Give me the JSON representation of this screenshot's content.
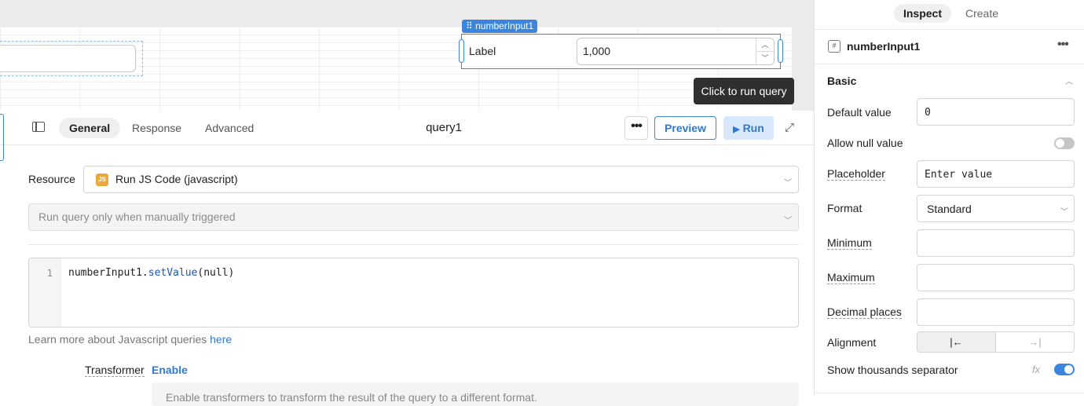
{
  "canvas": {
    "component_tag": "numberInput1",
    "number_input": {
      "label": "Label",
      "value": "1,000"
    },
    "tooltip": "Click to run query"
  },
  "query_editor": {
    "tabs": [
      {
        "label": "General",
        "active": true
      },
      {
        "label": "Response",
        "active": false
      },
      {
        "label": "Advanced",
        "active": false
      }
    ],
    "query_name": "query1",
    "more_label": "•••",
    "preview_label": "Preview",
    "run_label": "Run",
    "resource_label": "Resource",
    "resource_badge": "JS",
    "resource_value": "Run JS Code (javascript)",
    "trigger_value": "Run query only when manually triggered",
    "code": {
      "line_number": "1",
      "object": "numberInput1",
      "dot": ".",
      "method": "setValue",
      "args": "(null)"
    },
    "learn_text": "Learn more about Javascript queries ",
    "learn_link": "here",
    "transformer_label": "Transformer",
    "transformer_enable": "Enable",
    "transformer_hint": "Enable transformers to transform the result of the query to a different format."
  },
  "inspector": {
    "tabs": [
      "Inspect",
      "Create"
    ],
    "component_name": "numberInput1",
    "component_icon": "#",
    "more_label": "•••",
    "section": "Basic",
    "props": {
      "default_value_label": "Default value",
      "default_value": "0",
      "allow_null_label": "Allow null value",
      "allow_null": false,
      "placeholder_label": "Placeholder",
      "placeholder_value": "Enter value",
      "format_label": "Format",
      "format_value": "Standard",
      "minimum_label": "Minimum",
      "maximum_label": "Maximum",
      "decimal_label": "Decimal places",
      "alignment_label": "Alignment",
      "alignment_left": "|←",
      "alignment_right": "→|",
      "thousands_label": "Show thousands separator",
      "thousands_separator": true,
      "fx_label": "fx"
    }
  },
  "colors": {
    "accent": "#3b86dc",
    "tooltip_bg": "#2f2f2f",
    "js_badge": "#e8a93d"
  }
}
